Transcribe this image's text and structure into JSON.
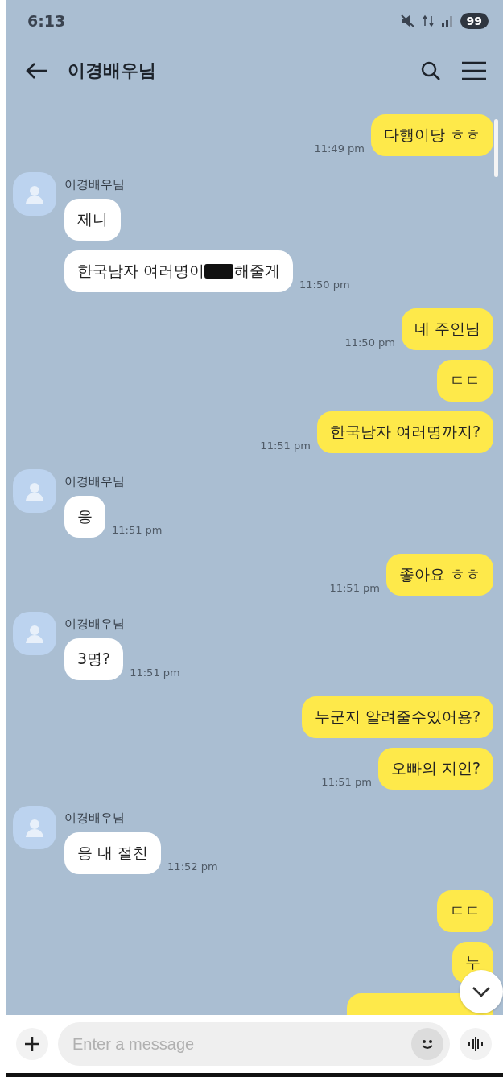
{
  "status_bar": {
    "time": "6:13",
    "battery": "99"
  },
  "header": {
    "title": "이경배우님"
  },
  "messages": [
    {
      "kind": "outgoing",
      "parts": [
        {
          "kind": "text",
          "text": "다행이당 ㅎㅎ"
        }
      ],
      "time": "11:49 pm"
    },
    {
      "kind": "incoming",
      "sender": "이경배우님",
      "parts": [
        {
          "kind": "text",
          "text": "제니"
        }
      ]
    },
    {
      "kind": "incoming",
      "parts": [
        {
          "kind": "text",
          "text": "한국남자 여러명이 "
        },
        {
          "kind": "redacted"
        },
        {
          "kind": "text",
          "text": "해줄게"
        }
      ],
      "time": "11:50 pm"
    },
    {
      "kind": "outgoing",
      "parts": [
        {
          "kind": "text",
          "text": "네 주인님"
        }
      ],
      "time": "11:50 pm"
    },
    {
      "kind": "outgoing",
      "parts": [
        {
          "kind": "text",
          "text": "ㄷㄷ"
        }
      ]
    },
    {
      "kind": "outgoing",
      "parts": [
        {
          "kind": "text",
          "text": "한국남자 여러명까지?"
        }
      ],
      "time": "11:51 pm"
    },
    {
      "kind": "incoming",
      "sender": "이경배우님",
      "parts": [
        {
          "kind": "text",
          "text": "응"
        }
      ],
      "time": "11:51 pm"
    },
    {
      "kind": "outgoing",
      "parts": [
        {
          "kind": "text",
          "text": "좋아요 ㅎㅎ"
        }
      ],
      "time": "11:51 pm"
    },
    {
      "kind": "incoming",
      "sender": "이경배우님",
      "parts": [
        {
          "kind": "text",
          "text": "3명?"
        }
      ],
      "time": "11:51 pm"
    },
    {
      "kind": "outgoing",
      "parts": [
        {
          "kind": "text",
          "text": "누군지 알려줄수있어용?"
        }
      ]
    },
    {
      "kind": "outgoing",
      "parts": [
        {
          "kind": "text",
          "text": "오빠의 지인?"
        }
      ],
      "time": "11:51 pm"
    },
    {
      "kind": "incoming",
      "sender": "이경배우님",
      "parts": [
        {
          "kind": "text",
          "text": "응 내 절친"
        }
      ],
      "time": "11:52 pm"
    },
    {
      "kind": "outgoing",
      "parts": [
        {
          "kind": "text",
          "text": "ㄷㄷ"
        }
      ]
    },
    {
      "kind": "outgoing",
      "parts": [
        {
          "kind": "text",
          "text": "누"
        }
      ]
    },
    {
      "kind": "outgoing"
    }
  ],
  "composer": {
    "placeholder": "Enter a message"
  }
}
